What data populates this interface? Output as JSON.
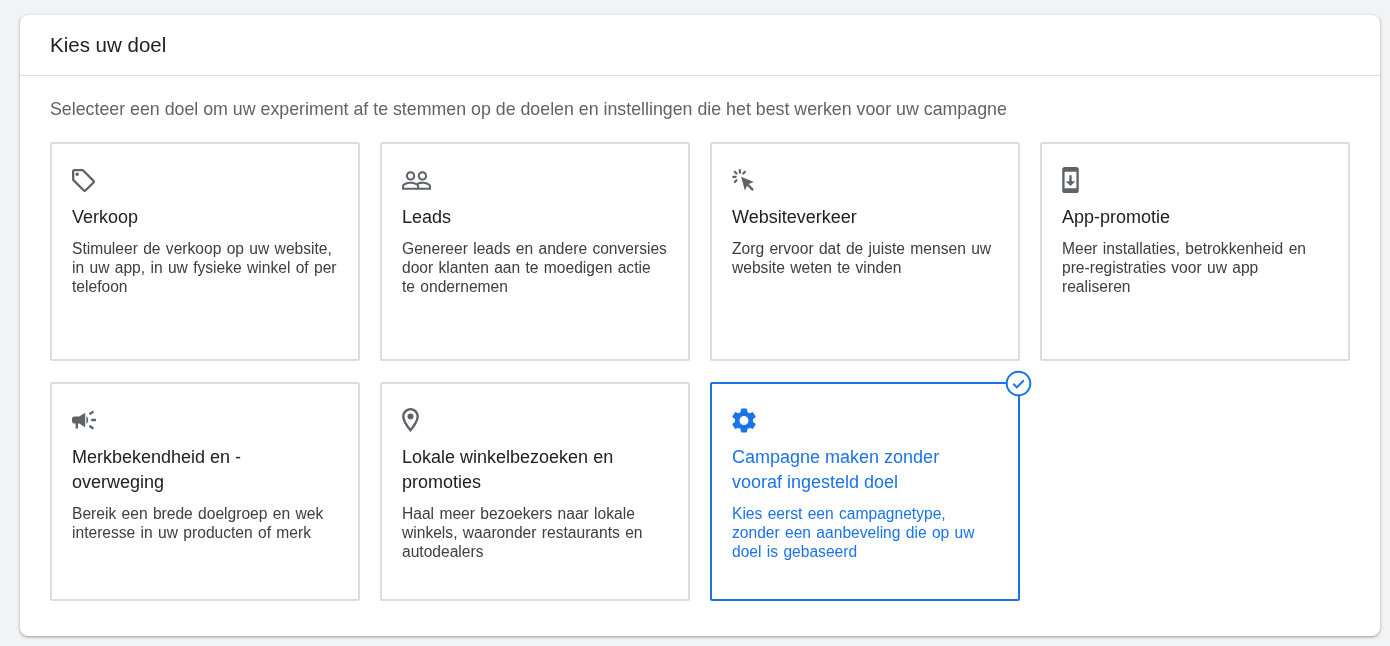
{
  "panel": {
    "title": "Kies uw doel",
    "intro": "Selecteer een doel om uw experiment af te stemmen op de doelen en instellingen die het best werken voor uw campagne"
  },
  "goals": [
    {
      "kind": "sales",
      "title": "Verkoop",
      "description": "Stimuleer de verkoop op uw website, in uw app, in uw fysieke winkel of per telefoon",
      "selected": false
    },
    {
      "kind": "leads",
      "title": "Leads",
      "description": "Genereer leads en andere conversies door klanten aan te moedigen actie te ondernemen",
      "selected": false
    },
    {
      "kind": "traffic",
      "title": "Websiteverkeer",
      "description": "Zorg ervoor dat de juiste mensen uw website weten te vinden",
      "selected": false
    },
    {
      "kind": "app",
      "title": "App-promotie",
      "description": "Meer installaties, betrokkenheid en pre-registraties voor uw app realiseren",
      "selected": false
    },
    {
      "kind": "awareness",
      "title": "Merkbekendheid en -overweging",
      "description": "Bereik een brede doelgroep en wek interesse in uw producten of merk",
      "selected": false
    },
    {
      "kind": "local",
      "title": "Lokale winkelbezoeken en promoties",
      "description": "Haal meer bezoekers naar lokale winkels, waaronder restaurants en autodealers",
      "selected": false
    },
    {
      "kind": "none",
      "title": "Campagne maken zonder vooraf ingesteld doel",
      "description": "Kies eerst een campagnetype, zonder een aanbeveling die op uw doel is gebaseerd",
      "selected": true
    }
  ]
}
